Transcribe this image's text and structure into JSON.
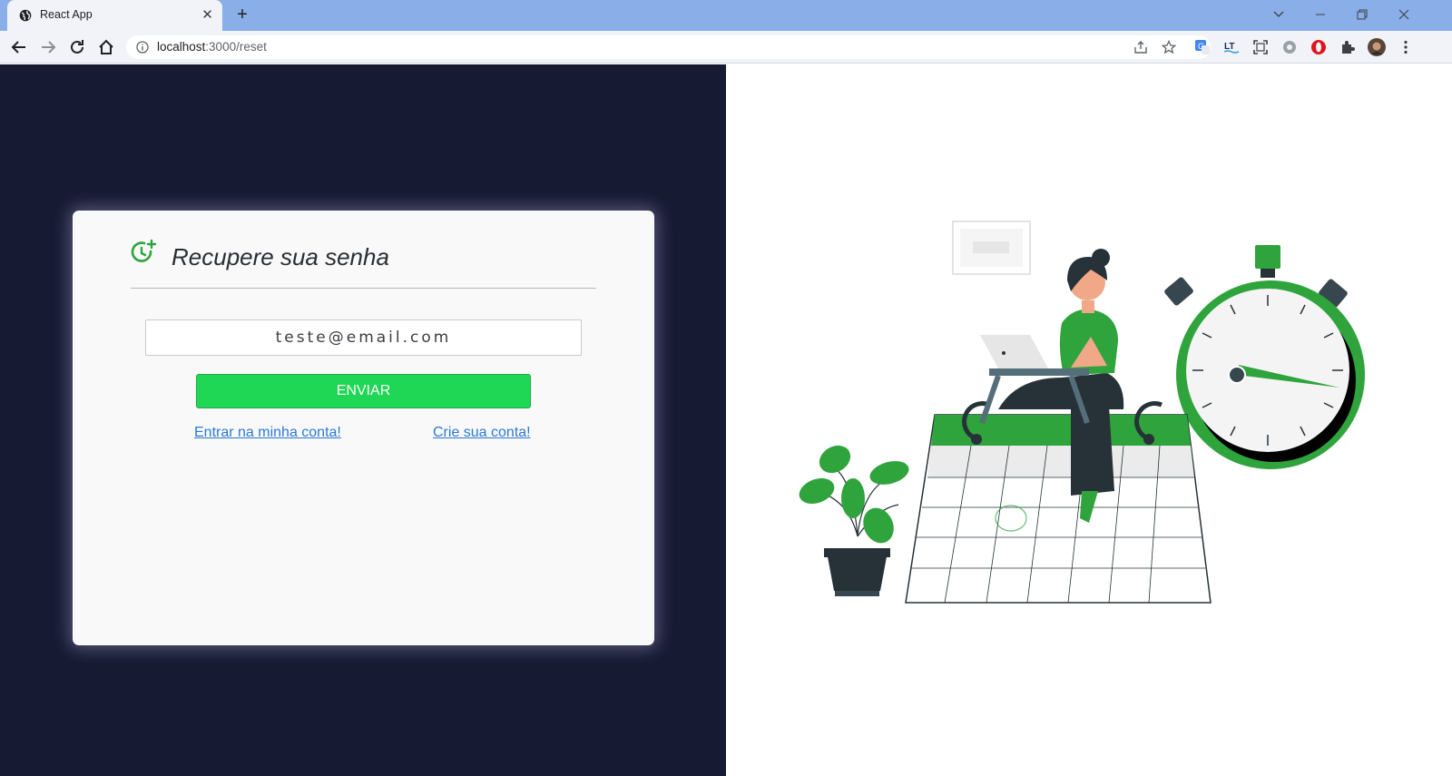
{
  "browser": {
    "tab_title": "React App",
    "url_host": "localhost",
    "url_rest": ":3000/reset"
  },
  "page": {
    "heading": "Recupere sua senha",
    "email_value": "teste@email.com",
    "send_label": "ENVIAR",
    "login_link": "Entrar na minha conta!",
    "signup_link": "Crie sua conta!"
  },
  "colors": {
    "left_bg": "#171a33",
    "accent_green": "#1fd655",
    "link_blue": "#2b79d8",
    "illustration_green": "#3aa935"
  }
}
